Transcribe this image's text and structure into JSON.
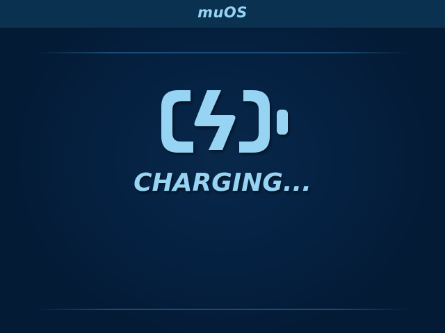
{
  "header": {
    "title": "muOS"
  },
  "charging": {
    "icon": "battery-charging-icon",
    "status_text": "CHARGING..."
  },
  "colors": {
    "background": "#041b36",
    "header_bg": "#0a3150",
    "accent": "#97d4f4",
    "divider": "#1a4d75"
  }
}
